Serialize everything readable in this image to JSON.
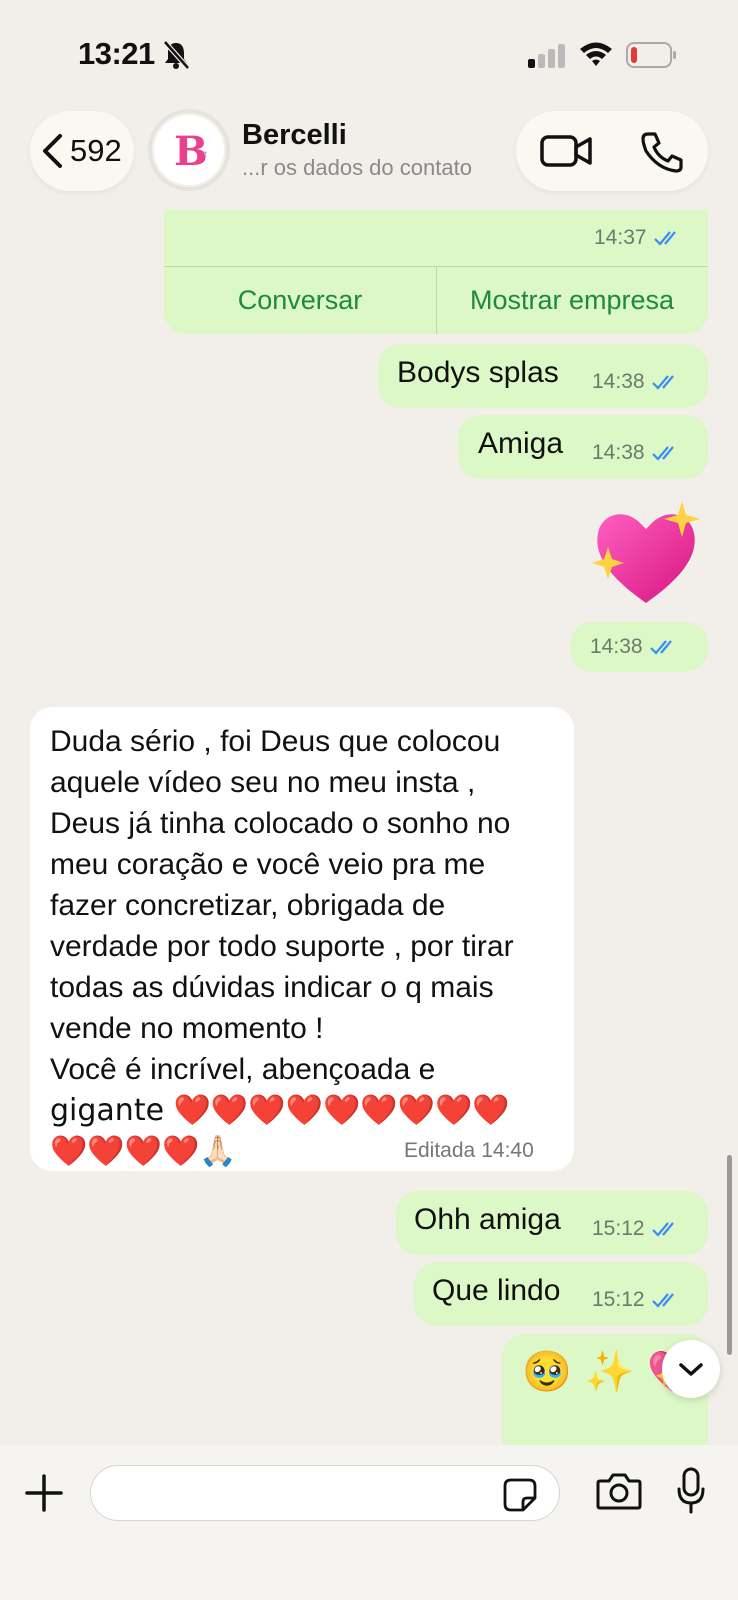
{
  "status_bar": {
    "time": "13:21"
  },
  "header": {
    "back_count": "592",
    "contact_name": "Bercelli",
    "contact_subtitle": "...r os dados do contato",
    "avatar_letter": "B"
  },
  "business_card": {
    "time": "14:37",
    "chat_button": "Conversar",
    "show_business_button": "Mostrar empresa"
  },
  "messages": [
    {
      "direction": "out",
      "text": "Bodys splas",
      "time": "14:38"
    },
    {
      "direction": "out",
      "text": "Amiga",
      "time": "14:38"
    },
    {
      "direction": "out",
      "text": "💖",
      "time": "14:38",
      "sticker": true
    },
    {
      "direction": "in",
      "lines": [
        "Duda sério , foi Deus que colocou",
        "aquele vídeo seu no meu insta ,",
        "Deus já tinha colocado o sonho no",
        "meu coração e você veio pra me",
        "fazer concretizar, obrigada de",
        "verdade por todo suporte , por tirar",
        "todas as dúvidas indicar o q mais",
        "vende no momento !",
        "Você é incrível, abençoada e",
        "gigante ❤️❤️❤️❤️❤️❤️❤️❤️❤️",
        "❤️❤️❤️❤️🙏🏻"
      ],
      "edited_label": "Editada",
      "time": "14:40"
    },
    {
      "direction": "out",
      "text": "Ohh amiga",
      "time": "15:12"
    },
    {
      "direction": "out",
      "text": "Que lindo",
      "time": "15:12"
    },
    {
      "direction": "out",
      "text": "🥹 ✨ 💖",
      "time": ""
    }
  ],
  "colors": {
    "outgoing_bubble": "#dcf8c6",
    "incoming_bubble": "#ffffff",
    "chat_background": "#f2efea",
    "read_ticks": "#3a8df0",
    "business_button_text": "#1d8a3c"
  },
  "icons": [
    "bell-off-icon",
    "signal-icon",
    "wifi-icon",
    "battery-icon",
    "chevron-left-icon",
    "video-call-icon",
    "phone-call-icon",
    "plus-icon",
    "sticker-icon",
    "camera-icon",
    "microphone-icon",
    "chevron-down-icon"
  ]
}
